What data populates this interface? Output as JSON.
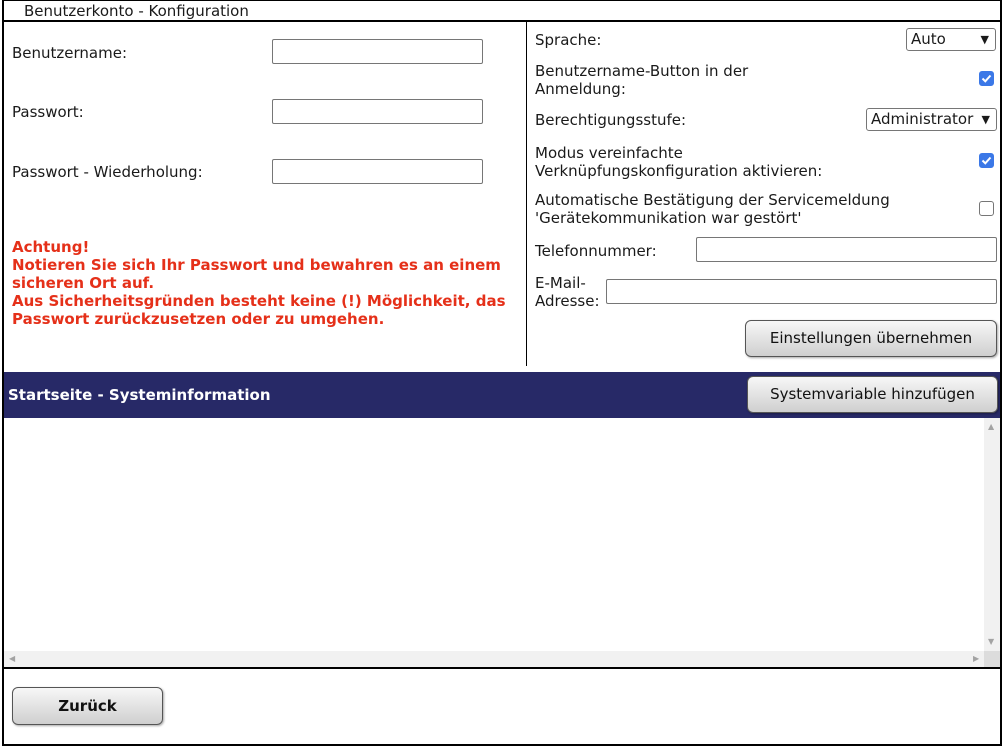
{
  "title": "Benutzerkonto - Konfiguration",
  "account": {
    "username_label": "Benutzername:",
    "username_value": "",
    "password_label": "Passwort:",
    "password_value": "",
    "password_repeat_label": "Passwort - Wiederholung:",
    "password_repeat_value": ""
  },
  "warning": {
    "lines": [
      "Achtung!",
      "Notieren Sie sich Ihr Passwort und bewahren es an einem",
      "sicheren Ort auf.",
      "Aus Sicherheitsgründen besteht keine (!) Möglichkeit, das",
      "Passwort zurückzusetzen oder zu umgehen."
    ],
    "color": "#e53019"
  },
  "settings": {
    "language_label": "Sprache:",
    "language_value": "Auto",
    "username_button_label_1": "Benutzername-Button in der",
    "username_button_label_2": "Anmeldung:",
    "username_button_checked": true,
    "permission_label": "Berechtigungsstufe:",
    "permission_value": "Administrator",
    "simplified_mode_label_1": "Modus vereinfachte",
    "simplified_mode_label_2": "Verknüpfungskonfiguration aktivieren:",
    "simplified_mode_checked": true,
    "auto_confirm_label_1": "Automatische Bestätigung der Servicemeldung",
    "auto_confirm_label_2": "'Gerätekommunikation war gestört'",
    "auto_confirm_checked": false,
    "phone_label": "Telefonnummer:",
    "phone_value": "",
    "email_label_1": "E-Mail-",
    "email_label_2": "Adresse:",
    "email_value": "",
    "apply_button": "Einstellungen übernehmen"
  },
  "section": {
    "title": "Startseite - Systeminformation",
    "add_button": "Systemvariable hinzufügen",
    "bar_color": "#272967"
  },
  "footer": {
    "back_button": "Zurück"
  }
}
